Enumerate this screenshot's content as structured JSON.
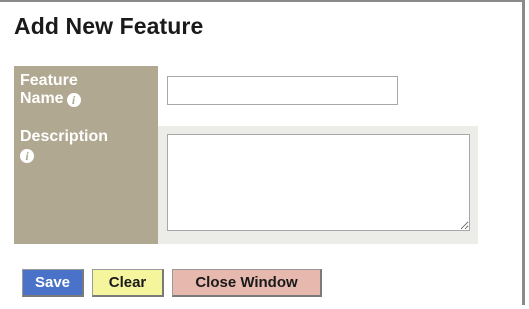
{
  "page": {
    "title": "Add New Feature"
  },
  "form": {
    "feature_name": {
      "label_line1": "Feature",
      "label_line2": "Name",
      "value": "",
      "info_icon": "info-icon"
    },
    "description": {
      "label": "Description",
      "value": "",
      "info_icon": "info-icon"
    }
  },
  "buttons": {
    "save_label": "Save",
    "clear_label": "Clear",
    "close_label": "Close Window"
  },
  "colors": {
    "label_bg": "#b0a890",
    "field_bg": "#ecece8",
    "save_bg": "#4a72c8",
    "clear_bg": "#f5f59e",
    "close_bg": "#e7b8ae"
  }
}
